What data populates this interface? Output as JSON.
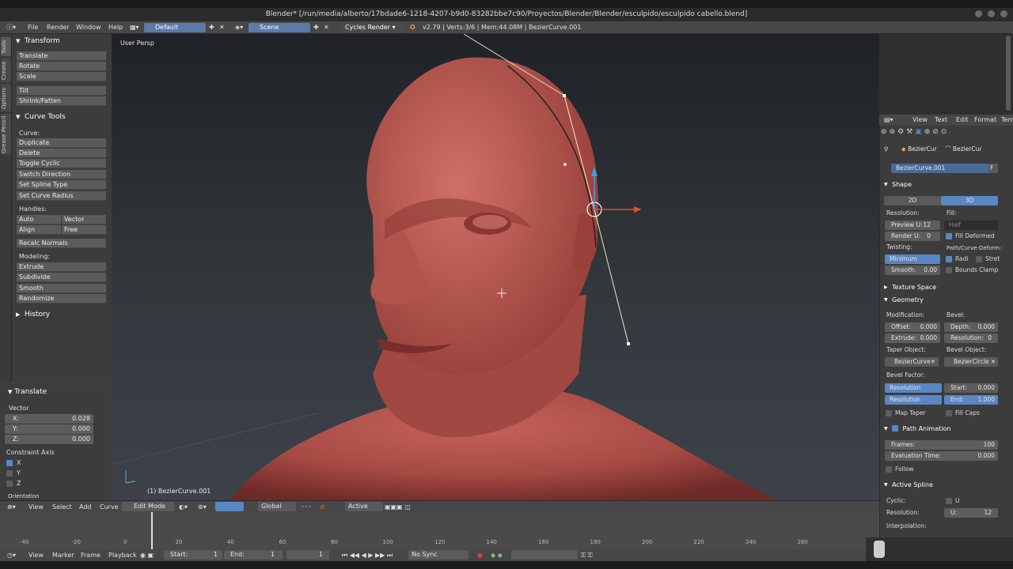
{
  "window": {
    "title": "Blender* [/run/media/alberto/17bdade6-1218-4207-b9d0-83282bbe7c90/Proyectos/Blender/Blender/esculpido/esculpido cabello.blend]"
  },
  "menubar": {
    "items": [
      "File",
      "Render",
      "Window",
      "Help"
    ],
    "layout": "Default",
    "scene": "Scene",
    "engine": "Cycles Render",
    "stats": "v2.79 | Verts:3/6 | Mem:44.08M | BezierCurve.001"
  },
  "left_tabs": [
    "Tools",
    "Create",
    "Options",
    "Grease Pencil"
  ],
  "tool_panel": {
    "transform_title": "Transform",
    "transform_buttons": [
      "Translate",
      "Rotate",
      "Scale"
    ],
    "transform_buttons2": [
      "Tilt",
      "Shrink/Fatten"
    ],
    "curve_tools_title": "Curve Tools",
    "curve_label": "Curve:",
    "curve_buttons": [
      "Duplicate",
      "Delete",
      "Toggle Cyclic",
      "Switch Direction",
      "Set Spline Type",
      "Set Curve Radius"
    ],
    "handles_label": "Handles:",
    "handles_buttons": [
      "Auto",
      "Vector",
      "Align",
      "Free"
    ],
    "recalc": "Recalc Normals",
    "modeling_label": "Modeling:",
    "modeling_buttons": [
      "Extrude",
      "Subdivide",
      "Smooth",
      "Randomize"
    ],
    "history_title": "History"
  },
  "operator": {
    "title": "Translate",
    "vector_label": "Vector",
    "x_label": "X:",
    "x": "0.028",
    "y_label": "Y:",
    "y": "0.000",
    "z_label": "Z:",
    "z": "0.000",
    "constraint_label": "Constraint Axis",
    "axes": [
      "X",
      "Y",
      "Z"
    ],
    "orientation_label": "Orientation"
  },
  "viewport": {
    "view_label": "User Persp",
    "object_label": "(1) BezierCurve.001"
  },
  "view_header": {
    "menus": [
      "View",
      "Select",
      "Add",
      "Curve"
    ],
    "mode": "Edit Mode",
    "orientation": "Global",
    "pivot": "Active"
  },
  "timeline": {
    "ticks": [
      "-40",
      "-20",
      "0",
      "20",
      "40",
      "60",
      "80",
      "100",
      "120",
      "140",
      "160",
      "180",
      "200",
      "220",
      "240",
      "260"
    ],
    "menus": [
      "View",
      "Marker",
      "Frame",
      "Playback"
    ],
    "start_label": "Start:",
    "start": "1",
    "end_label": "End:",
    "end": "1",
    "current": "1",
    "sync": "No Sync"
  },
  "text_editor_header": {
    "menus": [
      "View",
      "Text",
      "Edit",
      "Format",
      "Tem"
    ]
  },
  "properties": {
    "breadcrumb": [
      "BezierCur",
      "BezierCur"
    ],
    "object_name": "BezierCurve.001",
    "users": "F",
    "shape_title": "Shape",
    "shape_2d": "2D",
    "shape_3d": "3D",
    "resolution_label": "Resolution:",
    "fill_label": "Fill:",
    "preview_u_label": "Preview U:",
    "preview_u": "12",
    "render_u_label": "Render U:",
    "render_u": "0",
    "fill_mode": "Half",
    "fill_deformed": "Fill Deformed",
    "twisting_label": "Twisting:",
    "path_deform_label": "Path/Curve-Deform:",
    "twisting_mode": "Minimum",
    "radius": "Radi",
    "stretch": "Stret",
    "smooth_label": "Smooth:",
    "smooth": "0.00",
    "bounds_clamp": "Bounds Clamp",
    "texture_space_title": "Texture Space",
    "geometry_title": "Geometry",
    "modification_label": "Modification:",
    "bevel_label": "Bevel:",
    "offset_label": "Offset:",
    "offset": "0.000",
    "depth_label": "Depth:",
    "depth": "0.000",
    "extrude_label": "Extrude:",
    "extrude": "0.000",
    "bevel_resolution_label": "Resolution:",
    "bevel_resolution": "0",
    "taper_object_label": "Taper Object:",
    "bevel_object_label": "Bevel Object:",
    "taper_object": "BezierCurve",
    "bevel_object": "BezierCircle",
    "bevel_factor_label": "Bevel Factor:",
    "factor_mode_start": "Resolution",
    "factor_mode_end": "Resolution",
    "start_label": "Start:",
    "start": "0.000",
    "end_label": "End:",
    "end": "1.000",
    "map_taper": "Map Taper",
    "fill_caps": "Fill Caps",
    "path_animation_title": "Path Animation",
    "frames_label": "Frames:",
    "frames": "100",
    "eval_time_label": "Evaluation Time:",
    "eval_time": "0.000",
    "follow": "Follow",
    "active_spline_title": "Active Spline",
    "cyclic_label": "Cyclic:",
    "cyclic_u": "U",
    "spline_resolution_label": "Resolution:",
    "spline_u_label": "U:",
    "spline_u": "12",
    "interpolation_label": "Interpolation:"
  },
  "colors": {
    "skin": "#b85a52",
    "accent_blue": "#5a86c2",
    "curve_line": "#f0e6c8",
    "gizmo_red": "#e0502a",
    "gizmo_blue": "#3aa0e8"
  }
}
